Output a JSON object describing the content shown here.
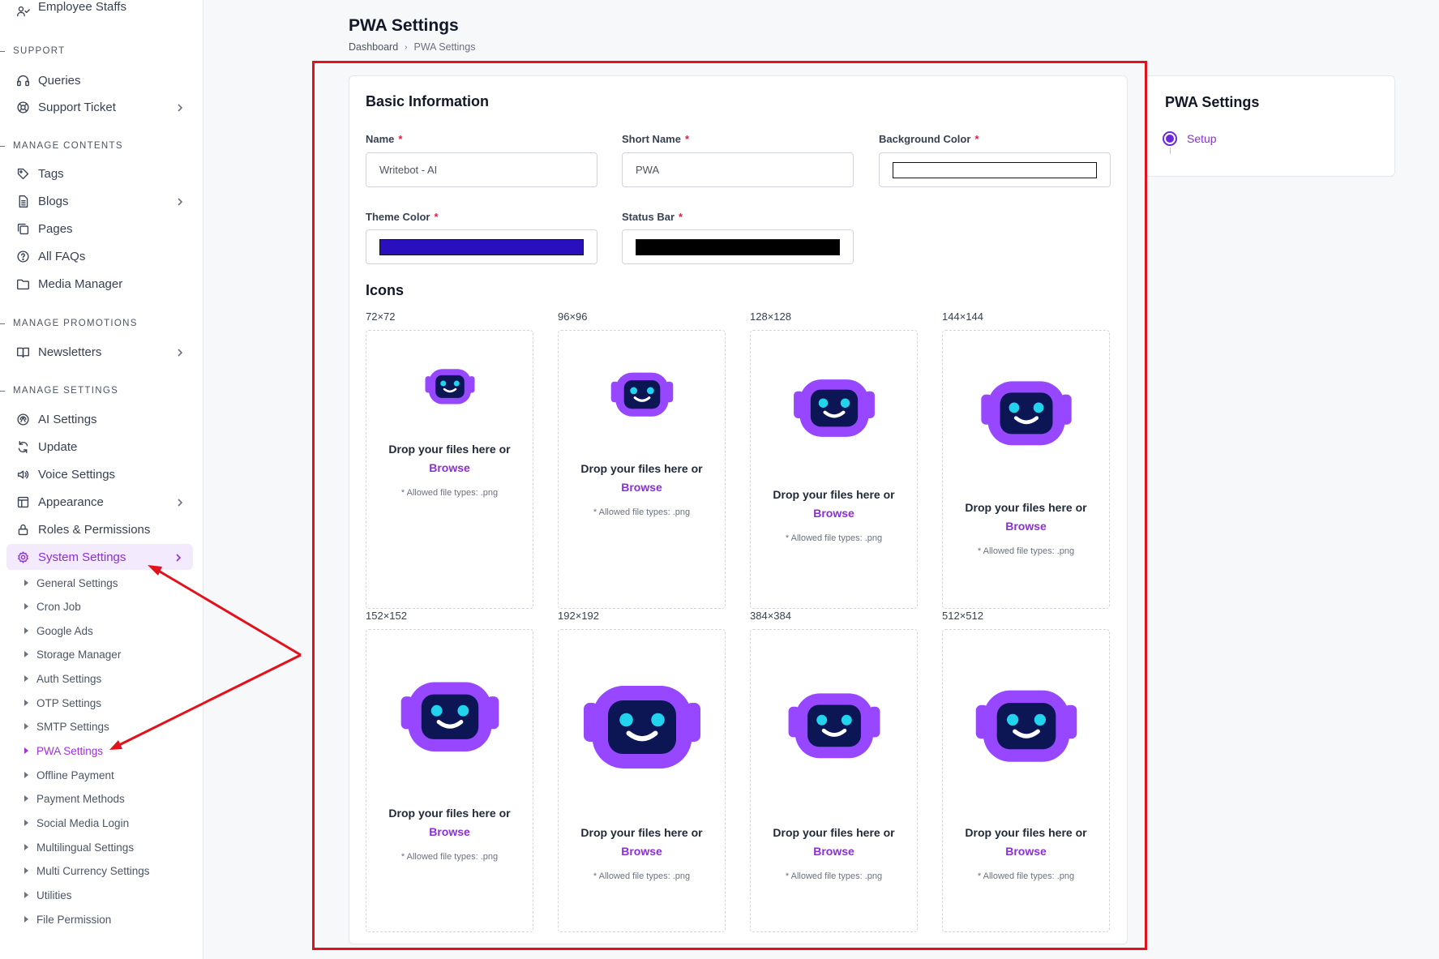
{
  "sidebar": {
    "top_item": "Employee Staffs",
    "sections": [
      {
        "heading": "SUPPORT",
        "items": [
          {
            "label": "Queries",
            "icon": "headset-icon",
            "chevron": false
          },
          {
            "label": "Support Ticket",
            "icon": "lifebuoy-icon",
            "chevron": true
          }
        ]
      },
      {
        "heading": "MANAGE CONTENTS",
        "items": [
          {
            "label": "Tags",
            "icon": "tag-icon",
            "chevron": false
          },
          {
            "label": "Blogs",
            "icon": "document-icon",
            "chevron": true
          },
          {
            "label": "Pages",
            "icon": "copy-icon",
            "chevron": false
          },
          {
            "label": "All FAQs",
            "icon": "question-circle-icon",
            "chevron": false
          },
          {
            "label": "Media Manager",
            "icon": "folder-icon",
            "chevron": false
          }
        ]
      },
      {
        "heading": "MANAGE PROMOTIONS",
        "items": [
          {
            "label": "Newsletters",
            "icon": "book-open-icon",
            "chevron": true
          }
        ]
      },
      {
        "heading": "MANAGE SETTINGS",
        "items": [
          {
            "label": "AI Settings",
            "icon": "ai-icon",
            "chevron": false
          },
          {
            "label": "Update",
            "icon": "refresh-icon",
            "chevron": false
          },
          {
            "label": "Voice Settings",
            "icon": "speaker-icon",
            "chevron": false
          },
          {
            "label": "Appearance",
            "icon": "layout-icon",
            "chevron": true
          },
          {
            "label": "Roles & Permissions",
            "icon": "lock-icon",
            "chevron": false
          },
          {
            "label": "System Settings",
            "icon": "gear-icon",
            "chevron": true,
            "active": true
          }
        ]
      }
    ],
    "submenu": [
      "General Settings",
      "Cron Job",
      "Google Ads",
      "Storage Manager",
      "Auth Settings",
      "OTP Settings",
      "SMTP Settings",
      "PWA Settings",
      "Offline Payment",
      "Payment Methods",
      "Social Media Login",
      "Multilingual Settings",
      "Multi Currency Settings",
      "Utilities",
      "File Permission"
    ],
    "active_submenu": "PWA Settings"
  },
  "header": {
    "title": "PWA Settings",
    "breadcrumb": {
      "home": "Dashboard",
      "separator": "›",
      "current": "PWA Settings"
    }
  },
  "basic_info": {
    "title": "Basic Information",
    "name": {
      "label": "Name",
      "required": "*",
      "value": "Writebot - AI"
    },
    "short_name": {
      "label": "Short Name",
      "required": "*",
      "value": "PWA"
    },
    "background_color": {
      "label": "Background Color",
      "required": "*",
      "value": "#ffffff"
    },
    "theme_color": {
      "label": "Theme Color",
      "required": "*",
      "value": "#2a0fbe"
    },
    "status_bar": {
      "label": "Status Bar",
      "required": "*",
      "value": "#000000"
    }
  },
  "icons": {
    "title": "Icons",
    "drop_text": "Drop your files here or",
    "browse_text": "Browse",
    "allowed_text": "* Allowed file types: .png",
    "sizes": [
      "72×72",
      "96×96",
      "128×128",
      "144×144",
      "152×152",
      "192×192",
      "384×384",
      "512×512"
    ]
  },
  "side_panel": {
    "title": "PWA Settings",
    "steps": [
      "Setup"
    ]
  },
  "colors": {
    "accent": "#8b2fd6",
    "robot_body": "#9747ff",
    "robot_face": "#0d1654",
    "robot_eyes": "#22d3ee",
    "annotation": "#e3111b"
  }
}
